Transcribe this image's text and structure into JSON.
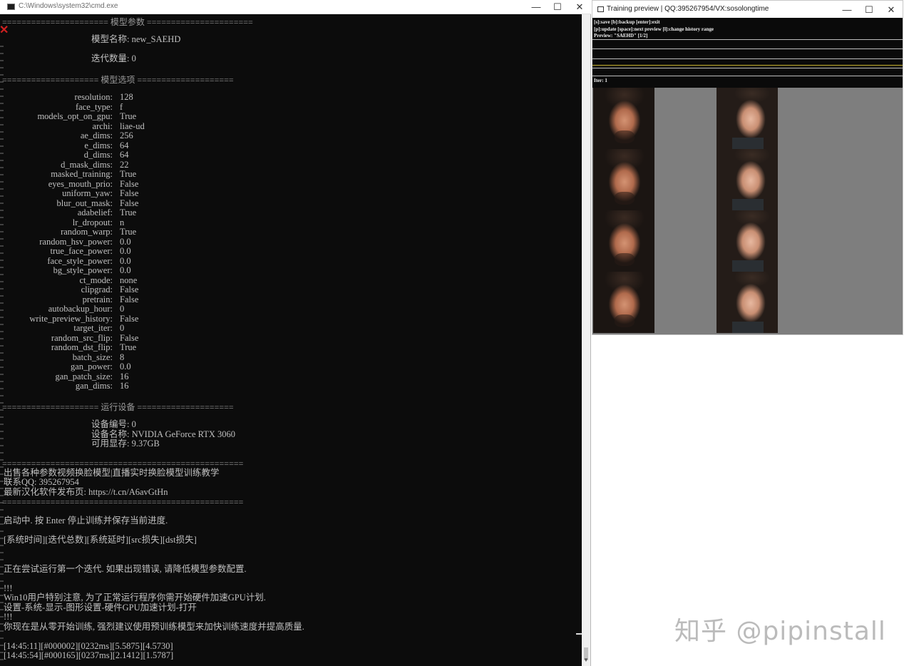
{
  "cmd_window": {
    "title": "C:\\Windows\\system32\\cmd.exe",
    "header_line": "====================== 模型参数 ======================",
    "model_name_label": "模型名称: ",
    "model_name": "new_SAEHD",
    "iterations_label": "迭代数量: ",
    "iterations": "0",
    "options_header": "==================== 模型选项 ====================",
    "options": [
      {
        "key": "resolution:",
        "value": "128"
      },
      {
        "key": "face_type:",
        "value": "f"
      },
      {
        "key": "models_opt_on_gpu:",
        "value": "True"
      },
      {
        "key": "archi:",
        "value": "liae-ud"
      },
      {
        "key": "ae_dims:",
        "value": "256"
      },
      {
        "key": "e_dims:",
        "value": "64"
      },
      {
        "key": "d_dims:",
        "value": "64"
      },
      {
        "key": "d_mask_dims:",
        "value": "22"
      },
      {
        "key": "masked_training:",
        "value": "True"
      },
      {
        "key": "eyes_mouth_prio:",
        "value": "False"
      },
      {
        "key": "uniform_yaw:",
        "value": "False"
      },
      {
        "key": "blur_out_mask:",
        "value": "False"
      },
      {
        "key": "adabelief:",
        "value": "True"
      },
      {
        "key": "lr_dropout:",
        "value": "n"
      },
      {
        "key": "random_warp:",
        "value": "True"
      },
      {
        "key": "random_hsv_power:",
        "value": "0.0"
      },
      {
        "key": "true_face_power:",
        "value": "0.0"
      },
      {
        "key": "face_style_power:",
        "value": "0.0"
      },
      {
        "key": "bg_style_power:",
        "value": "0.0"
      },
      {
        "key": "ct_mode:",
        "value": "none"
      },
      {
        "key": "clipgrad:",
        "value": "False"
      },
      {
        "key": "pretrain:",
        "value": "False"
      },
      {
        "key": "autobackup_hour:",
        "value": "0"
      },
      {
        "key": "write_preview_history:",
        "value": "False"
      },
      {
        "key": "target_iter:",
        "value": "0"
      },
      {
        "key": "random_src_flip:",
        "value": "False"
      },
      {
        "key": "random_dst_flip:",
        "value": "True"
      },
      {
        "key": "batch_size:",
        "value": "8"
      },
      {
        "key": "gan_power:",
        "value": "0.0"
      },
      {
        "key": "gan_patch_size:",
        "value": "16"
      },
      {
        "key": "gan_dims:",
        "value": "16"
      }
    ],
    "device_header": "==================== 运行设备 ====================",
    "device_index": "设备编号: 0",
    "device_name": "设备名称: NVIDIA GeForce RTX 3060",
    "device_vram": "可用显存: 9.37GB",
    "separator": "==================================================",
    "ad_line1": "出售各种参数视频换脸模型|直播实时换脸模型训练教学",
    "ad_line2": "联系QQ: 395267954",
    "ad_line3": "最新汉化软件发布页: https://t.cn/A6avGtHn",
    "starting": "启动中. 按 Enter 停止训练并保存当前进度.",
    "columns": "[系统时间][迭代总数][系统延时][src损失][dst损失]",
    "trying": "正在尝试运行第一个迭代. 如果出现错误, 请降低模型参数配置.",
    "bang1": "!!!",
    "win10_note": "Win10用户特别注意, 为了正常运行程序你需开始硬件加速GPU计划.",
    "settings_path": "设置-系统-显示-图形设置-硬件GPU加速计划-打开",
    "bang2": "!!!",
    "scratch_note": "你现在是从零开始训练, 强烈建议使用预训练模型来加快训练速度并提高质量.",
    "log1": "[14:45:11][#000002][0232ms][5.5875][4.5730]",
    "log2": "[14:45:54][#000165][0237ms][2.1412][1.5787]"
  },
  "preview_window": {
    "title": "Training preview | QQ:395267954/VX:sosolongtime",
    "hud_line1": "[s]:save [b]:backup [enter]:exit",
    "hud_line2": "[p]:update [space]:next preview [l]:change history range",
    "hud_line3": "Preview: \"SAEHD\" [1/2]",
    "iter_line": "Iter: 1"
  },
  "window_controls": {
    "minimize": "—",
    "maximize": "☐",
    "close": "✕"
  },
  "watermark": "知乎 @pipinstall"
}
